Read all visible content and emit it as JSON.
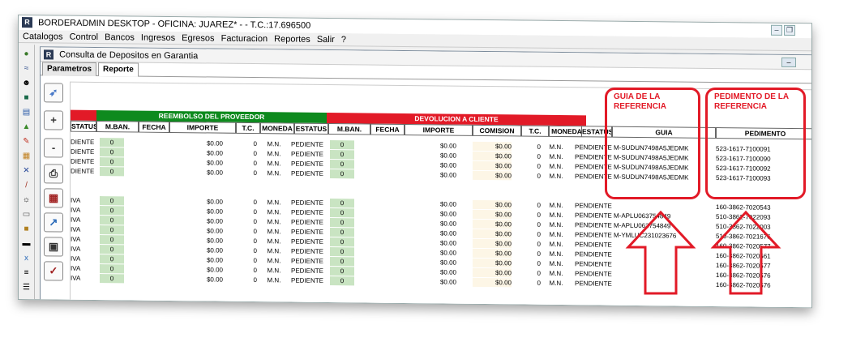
{
  "window": {
    "title": "BORDERADMIN DESKTOP - OFICINA: JUAREZ* -  - T.C.:17.696500",
    "logo": "R"
  },
  "menu": [
    "Catalogos",
    "Control",
    "Bancos",
    "Ingresos",
    "Egresos",
    "Facturacion",
    "Reportes",
    "Salir",
    "?"
  ],
  "child": {
    "title": "Consulta de Depositos en Garantia",
    "logo": "R"
  },
  "tabs": [
    "Parametros",
    "Reporte"
  ],
  "active_tab": "Reporte",
  "left_icons": [
    "money-bag-icon",
    "formula-icon",
    "person-icon",
    "book-icon",
    "document-icon",
    "flask-icon",
    "pen-icon",
    "calculator-icon",
    "network-icon",
    "pencil-icon",
    "gear-icon",
    "card-icon",
    "box-icon",
    "truck-icon",
    "xy-icon",
    "stack-icon",
    "list-icon"
  ],
  "left_tools": [
    "rocket-icon",
    "plus-icon",
    "minus-icon",
    "print-icon",
    "report-icon",
    "export-icon",
    "print-preview-icon",
    "checklist-icon"
  ],
  "groups": {
    "reembolso": "REEMBOLSO DEL PROVEEDOR",
    "devolucion": "DEVOLUCION A CLIENTE"
  },
  "headers": [
    "STATUS",
    "M.BAN.",
    "FECHA",
    "IMPORTE",
    "T.C.",
    "MONEDA",
    "ESTATUS",
    "M.BAN.",
    "FECHA",
    "IMPORTE",
    "COMISION",
    "T.C.",
    "MONEDA",
    "ESTATUS",
    "GUIA",
    "PEDIMENTO"
  ],
  "rows": [
    {
      "st": "DIENTE",
      "mb": "0",
      "imp": "$0.00",
      "tc": "0",
      "mon": "M.N.",
      "est": "PEDIENTE",
      "mb2": "0",
      "imp2": "$0.00",
      "com": "$0.00",
      "tc2": "0",
      "mon2": "M.N.",
      "est2": "PENDIENTE",
      "guia": "M-SUDUN7498A5JEDMK",
      "ped": "523-1617-7100091"
    },
    {
      "st": "DIENTE",
      "mb": "0",
      "imp": "$0.00",
      "tc": "0",
      "mon": "M.N.",
      "est": "PEDIENTE",
      "mb2": "0",
      "imp2": "$0.00",
      "com": "$0.00",
      "tc2": "0",
      "mon2": "M.N.",
      "est2": "PENDIENTE",
      "guia": "M-SUDUN7498A5JEDMK",
      "ped": "523-1617-7100090"
    },
    {
      "st": "DIENTE",
      "mb": "0",
      "imp": "$0.00",
      "tc": "0",
      "mon": "M.N.",
      "est": "PEDIENTE",
      "mb2": "0",
      "imp2": "$0.00",
      "com": "$0.00",
      "tc2": "0",
      "mon2": "M.N.",
      "est2": "PENDIENTE",
      "guia": "M-SUDUN7498A5JEDMK",
      "ped": "523-1617-7100092"
    },
    {
      "st": "DIENTE",
      "mb": "0",
      "imp": "$0.00",
      "tc": "0",
      "mon": "M.N.",
      "est": "PEDIENTE",
      "mb2": "0",
      "imp2": "$0.00",
      "com": "$0.00",
      "tc2": "0",
      "mon2": "M.N.",
      "est2": "PENDIENTE",
      "guia": "M-SUDUN7498A5JEDMK",
      "ped": "523-1617-7100093"
    },
    {
      "st": "IVA",
      "mb": "0",
      "imp": "$0.00",
      "tc": "0",
      "mon": "M.N.",
      "est": "PEDIENTE",
      "mb2": "0",
      "imp2": "$0.00",
      "com": "$0.00",
      "tc2": "0",
      "mon2": "M.N.",
      "est2": "PENDIENTE",
      "guia": "",
      "ped": "160-3862-7020543"
    },
    {
      "st": "IVA",
      "mb": "0",
      "imp": "$0.00",
      "tc": "0",
      "mon": "M.N.",
      "est": "PEDIENTE",
      "mb2": "0",
      "imp2": "$0.00",
      "com": "$0.00",
      "tc2": "0",
      "mon2": "M.N.",
      "est2": "PENDIENTE",
      "guia": "M-APLU063754849",
      "ped": "510-3862-7022093"
    },
    {
      "st": "IVA",
      "mb": "0",
      "imp": "$0.00",
      "tc": "0",
      "mon": "M.N.",
      "est": "PEDIENTE",
      "mb2": "0",
      "imp2": "$0.00",
      "com": "$0.00",
      "tc2": "0",
      "mon2": "M.N.",
      "est2": "PENDIENTE",
      "guia": "M-APLU063754849",
      "ped": "510-3862-7022003"
    },
    {
      "st": "IVA",
      "mb": "0",
      "imp": "$0.00",
      "tc": "0",
      "mon": "M.N.",
      "est": "PEDIENTE",
      "mb2": "0",
      "imp2": "$0.00",
      "com": "$0.00",
      "tc2": "0",
      "mon2": "M.N.",
      "est2": "PENDIENTE",
      "guia": "M-YMLUC231023676",
      "ped": "510-3862-7021676"
    },
    {
      "st": "IVA",
      "mb": "0",
      "imp": "$0.00",
      "tc": "0",
      "mon": "M.N.",
      "est": "PEDIENTE",
      "mb2": "0",
      "imp2": "$0.00",
      "com": "$0.00",
      "tc2": "0",
      "mon2": "M.N.",
      "est2": "PENDIENTE",
      "guia": "",
      "ped": "160-3862-7020577"
    },
    {
      "st": "IVA",
      "mb": "0",
      "imp": "$0.00",
      "tc": "0",
      "mon": "M.N.",
      "est": "PEDIENTE",
      "mb2": "0",
      "imp2": "$0.00",
      "com": "$0.00",
      "tc2": "0",
      "mon2": "M.N.",
      "est2": "PENDIENTE",
      "guia": "",
      "ped": "160-3862-7020561"
    },
    {
      "st": "IVA",
      "mb": "0",
      "imp": "$0.00",
      "tc": "0",
      "mon": "M.N.",
      "est": "PEDIENTE",
      "mb2": "0",
      "imp2": "$0.00",
      "com": "$0.00",
      "tc2": "0",
      "mon2": "M.N.",
      "est2": "PENDIENTE",
      "guia": "",
      "ped": "160-3862-7020577"
    },
    {
      "st": "IVA",
      "mb": "0",
      "imp": "$0.00",
      "tc": "0",
      "mon": "M.N.",
      "est": "PEDIENTE",
      "mb2": "0",
      "imp2": "$0.00",
      "com": "$0.00",
      "tc2": "0",
      "mon2": "M.N.",
      "est2": "PENDIENTE",
      "guia": "",
      "ped": "160-3862-7020576"
    },
    {
      "st": "IVA",
      "mb": "0",
      "imp": "$0.00",
      "tc": "0",
      "mon": "M.N.",
      "est": "PEDIENTE",
      "mb2": "0",
      "imp2": "$0.00",
      "com": "$0.00",
      "tc2": "0",
      "mon2": "M.N.",
      "est2": "PENDIENTE",
      "guia": "",
      "ped": "160-3862-7020576"
    }
  ],
  "annotations": {
    "guia": "GUIA DE LA REFERENCIA",
    "pedimento": "PEDIMENTO DE LA REFERENCIA"
  },
  "colors": {
    "green_group": "#0e8a1e",
    "red_group": "#e21a27",
    "annotation": "#e21a27"
  }
}
